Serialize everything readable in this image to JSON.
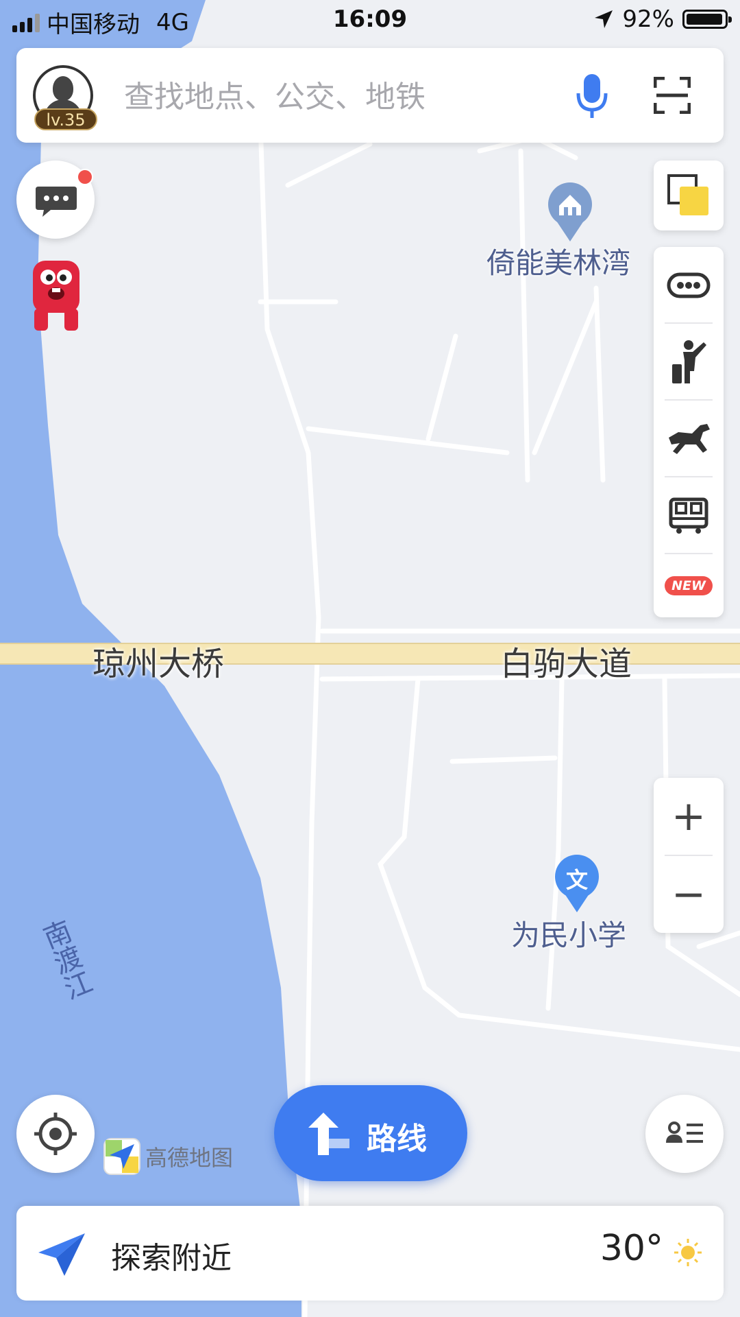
{
  "status_bar": {
    "carrier": "中国移动",
    "network": "4G",
    "time": "16:09",
    "battery": "92%"
  },
  "search": {
    "placeholder": "查找地点、公交、地铁",
    "level": "lv.35"
  },
  "map_labels": {
    "poi_residential": "倚能美林湾",
    "poi_school": "为民小学",
    "school_icon_text": "文",
    "bridge": "琼州大桥",
    "road": "白驹大道",
    "river": "南渡江"
  },
  "toolbar_right": {
    "new_badge": "NEW"
  },
  "zoom": {
    "in": "+",
    "out": "−"
  },
  "route_button": {
    "label": "路线"
  },
  "logo": {
    "text": "高德地图"
  },
  "bottom_bar": {
    "explore_label": "探索附近",
    "temperature": "30°"
  },
  "colors": {
    "river": "#8fb2ee",
    "land": "#eef0f4",
    "main_road": "#f6e7b5",
    "accent": "#3f7cf0",
    "badge_red": "#f0504b"
  },
  "icons": [
    "signal-icon",
    "location-arrow-icon",
    "battery-icon",
    "avatar-icon",
    "mic-icon",
    "scan-icon",
    "message-icon",
    "mascot-icon",
    "layers-icon",
    "traffic-icon",
    "taxi-icon",
    "horse-icon",
    "bus-icon",
    "residential-pin-icon",
    "school-pin-icon",
    "locate-icon",
    "route-arrow-icon",
    "list-icon",
    "paper-plane-icon",
    "sun-icon"
  ]
}
